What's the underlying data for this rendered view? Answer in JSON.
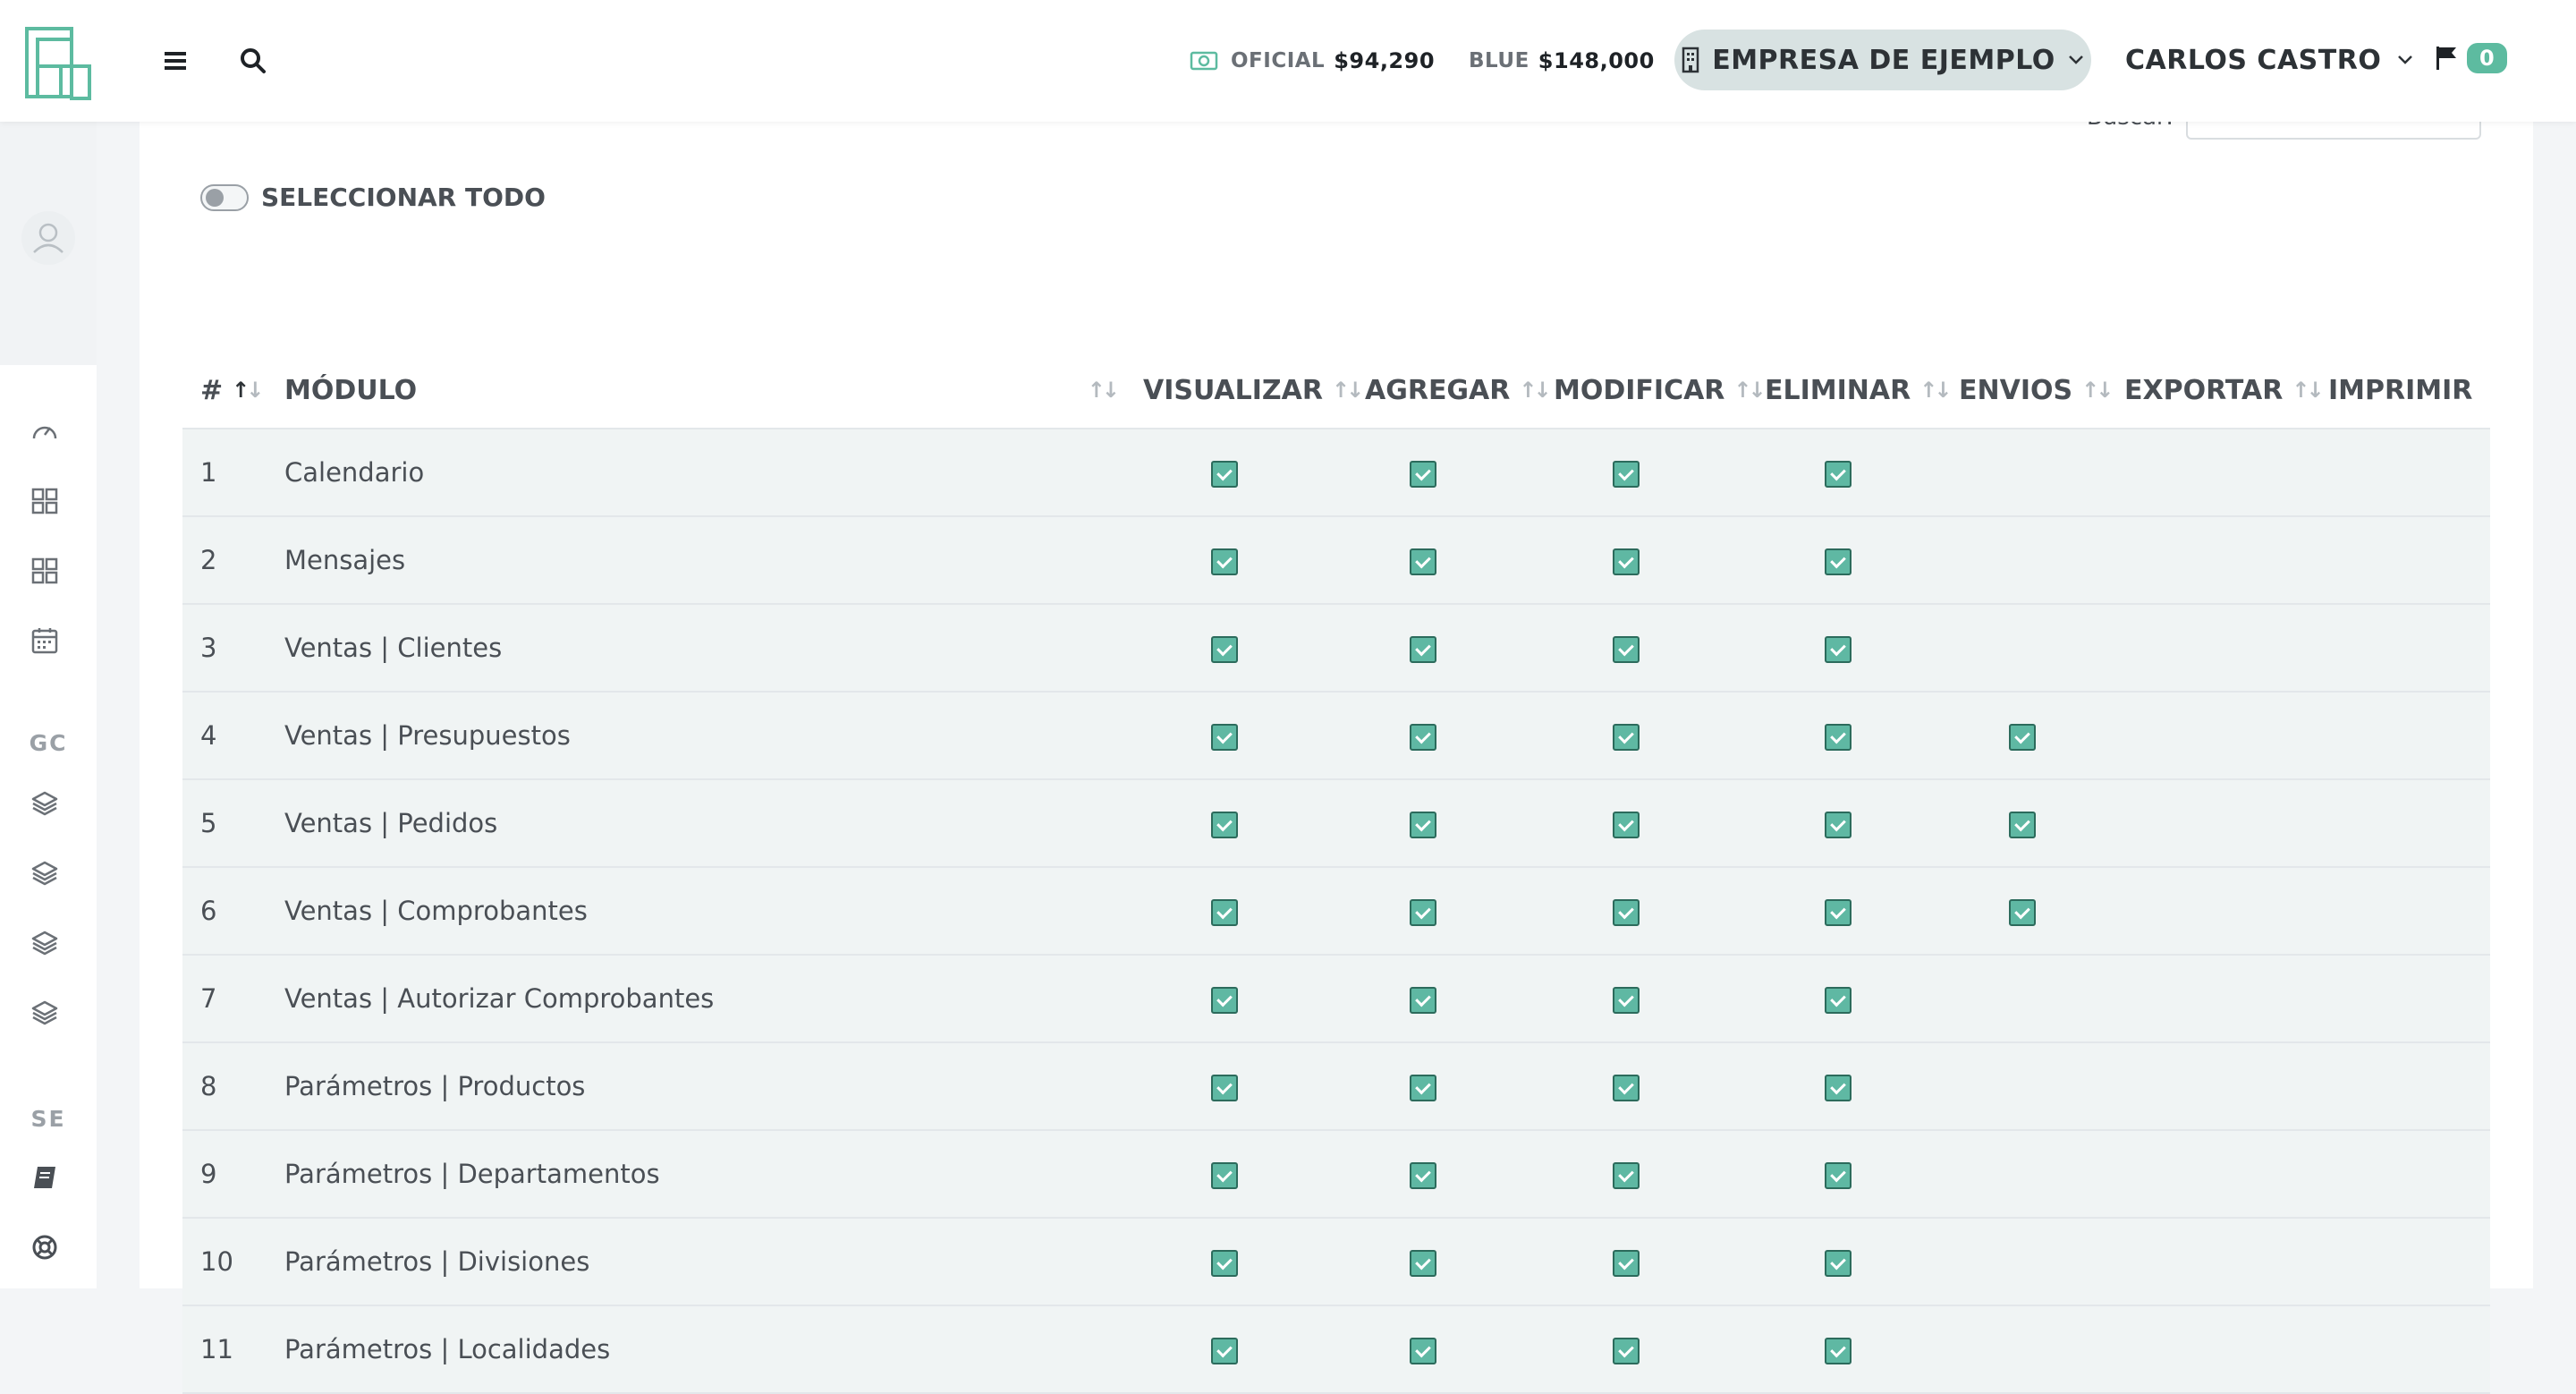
{
  "header": {
    "rates": [
      {
        "label": "OFICIAL",
        "value": "$94,290"
      },
      {
        "label": "BLUE",
        "value": "$148,000"
      }
    ],
    "company": "EMPRESA DE EJEMPLO",
    "user": "CARLOS CASTRO",
    "notifications": "0"
  },
  "sidebar": {
    "sections": [
      "GC",
      "SE"
    ]
  },
  "toolbar": {
    "search_label": "Buscar:",
    "select_all_label": "SELECCIONAR TODO"
  },
  "table": {
    "columns": {
      "num": "#",
      "module": "MÓDULO",
      "view": "VISUALIZAR",
      "add": "AGREGAR",
      "edit": "MODIFICAR",
      "delete": "ELIMINAR",
      "send": "ENVIOS",
      "export": "EXPORTAR",
      "print": "IMPRIMIR"
    },
    "rows": [
      {
        "num": "1",
        "module": "Calendario",
        "perms": [
          1,
          1,
          1,
          1,
          0,
          0,
          0
        ]
      },
      {
        "num": "2",
        "module": "Mensajes",
        "perms": [
          1,
          1,
          1,
          1,
          0,
          0,
          0
        ]
      },
      {
        "num": "3",
        "module": "Ventas | Clientes",
        "perms": [
          1,
          1,
          1,
          1,
          0,
          0,
          0
        ]
      },
      {
        "num": "4",
        "module": "Ventas | Presupuestos",
        "perms": [
          1,
          1,
          1,
          1,
          1,
          0,
          0
        ]
      },
      {
        "num": "5",
        "module": "Ventas | Pedidos",
        "perms": [
          1,
          1,
          1,
          1,
          1,
          0,
          0
        ]
      },
      {
        "num": "6",
        "module": "Ventas | Comprobantes",
        "perms": [
          1,
          1,
          1,
          1,
          1,
          0,
          0
        ]
      },
      {
        "num": "7",
        "module": "Ventas | Autorizar Comprobantes",
        "perms": [
          1,
          1,
          1,
          1,
          0,
          0,
          0
        ]
      },
      {
        "num": "8",
        "module": "Parámetros | Productos",
        "perms": [
          1,
          1,
          1,
          1,
          0,
          0,
          0
        ]
      },
      {
        "num": "9",
        "module": "Parámetros | Departamentos",
        "perms": [
          1,
          1,
          1,
          1,
          0,
          0,
          0
        ]
      },
      {
        "num": "10",
        "module": "Parámetros | Divisiones",
        "perms": [
          1,
          1,
          1,
          1,
          0,
          0,
          0
        ]
      },
      {
        "num": "11",
        "module": "Parámetros | Localidades",
        "perms": [
          1,
          1,
          1,
          1,
          0,
          0,
          0
        ]
      }
    ]
  }
}
